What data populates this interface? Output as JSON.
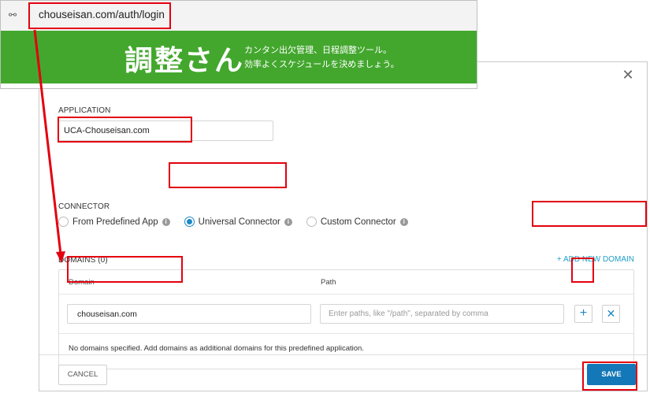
{
  "browser": {
    "url": "chouseisan.com/auth/login",
    "logo": "調整さん",
    "tagline_line1": "カンタン出欠管理、日程調整ツール。",
    "tagline_line2": "効率よくスケジュールを決めましょう。",
    "banner_color": "#43a72e"
  },
  "dialog": {
    "close_icon": "close-icon",
    "application_label": "APPLICATION",
    "application_value": "UCA-Chouseisan.com",
    "connector_label": "CONNECTOR",
    "connector_options": [
      {
        "label": "From Predefined App",
        "checked": false
      },
      {
        "label": "Universal Connector",
        "checked": true
      },
      {
        "label": "Custom Connector",
        "checked": false
      }
    ],
    "domains_label": "DOMAINS (0)",
    "add_domain_label": "+ ADD NEW DOMAIN",
    "table": {
      "col_domain": "Domain",
      "col_path": "Path",
      "domain_value": "chouseisan.com",
      "path_placeholder": "Enter paths, like \"/path\", separated by comma",
      "plus_label": "+",
      "remove_label": "✕",
      "note": "No domains specified. Add domains as additional domains for this predefined application."
    },
    "cancel_label": "CANCEL",
    "save_label": "SAVE"
  },
  "colors": {
    "accent": "#1e88c7",
    "save_bg": "#1478b8",
    "annotation_red": "#e3000f"
  }
}
